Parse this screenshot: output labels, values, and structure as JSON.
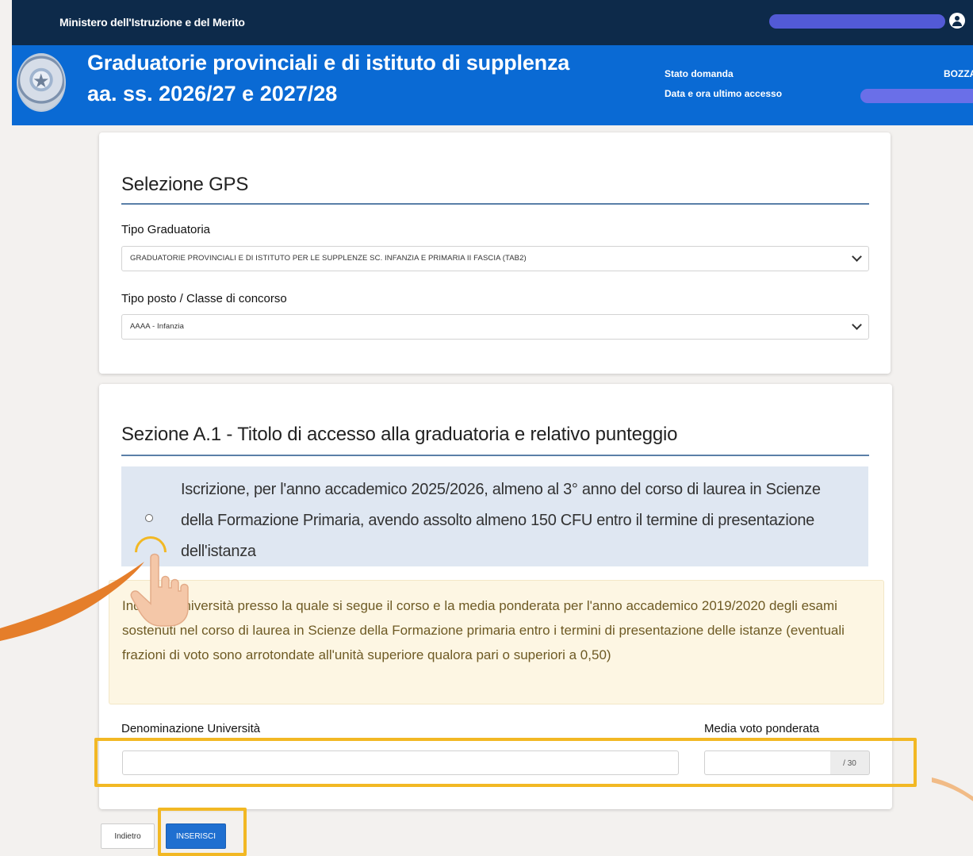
{
  "topbar": {
    "ministry": "Ministero dell'Istruzione e del Merito"
  },
  "header": {
    "title": "Graduatorie provinciali e di istituto di supplenza",
    "subtitle": "aa. ss. 2026/27 e 2027/28",
    "status_label": "Stato domanda",
    "status_value": "BOZZA",
    "last_access_label": "Data e ora ultimo accesso"
  },
  "gps": {
    "section_title": "Selezione GPS",
    "tipo_graduatoria_label": "Tipo Graduatoria",
    "tipo_graduatoria_value": "GRADUATORIE PROVINCIALI E DI ISTITUTO PER LE SUPPLENZE SC. INFANZIA E PRIMARIA II FASCIA (TAB2)",
    "tipo_posto_label": "Tipo posto / Classe di concorso",
    "tipo_posto_value": "AAAA - Infanzia"
  },
  "section_a1": {
    "title": "Sezione A.1 - Titolo di accesso alla graduatoria e relativo punteggio",
    "option_text": "Iscrizione, per l'anno accademico 2025/2026, almeno al 3° anno del corso di laurea in Scienze della Formazione Primaria, avendo assolto almeno 150 CFU entro il termine di presentazione dell'istanza",
    "info_text": "Indicare Università presso la quale si segue il corso e la media ponderata per l'anno accademico 2019/2020 degli esami sostenuti nel corso di laurea in Scienze della Formazione primaria entro i termini di presentazione delle istanze (eventuali frazioni di voto sono arrotondate all'unità superiore qualora pari o superiori a 0,50)",
    "university_label": "Denominazione Università",
    "grade_label": "Media voto ponderata",
    "grade_suffix": "/ 30"
  },
  "buttons": {
    "back": "Indietro",
    "insert": "INSERISCI"
  },
  "colors": {
    "topbar": "#0d2a4a",
    "header": "#0a6ad4",
    "highlight": "#f2b824",
    "primary_button": "#1f6fd0",
    "alert_bg": "#fdf6e3"
  }
}
